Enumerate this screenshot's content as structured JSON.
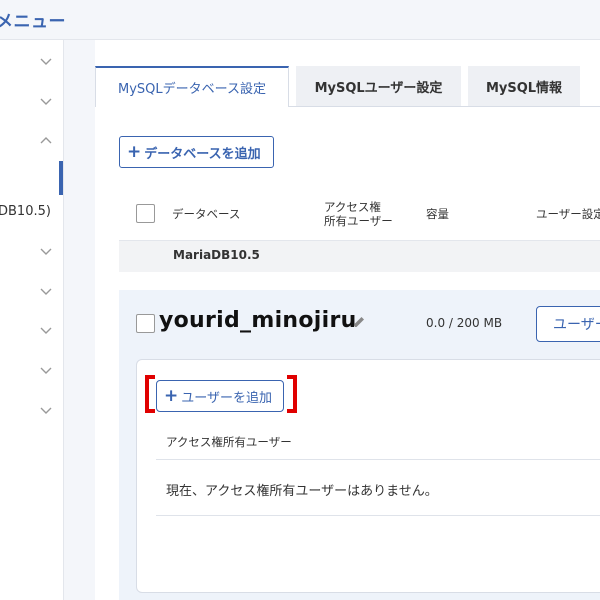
{
  "header": {
    "title": "メニュー"
  },
  "sidebar": {
    "partial_item_label": "DB10.5)"
  },
  "tabs": [
    {
      "label": "MySQLデータベース設定",
      "active": true
    },
    {
      "label": "MySQLユーザー設定",
      "active": false
    },
    {
      "label": "MySQL情報",
      "active": false
    }
  ],
  "actions": {
    "add_database": "データベースを追加"
  },
  "table": {
    "headers": {
      "database": "データベース",
      "access_line1": "アクセス権",
      "access_line2": "所有ユーザー",
      "capacity": "容量",
      "user_settings": "ユーザー設定"
    }
  },
  "group": {
    "label": "MariaDB10.5"
  },
  "database": {
    "name": "yourid_minojiru",
    "capacity": "0.0 / 200 MB",
    "user_button": "ユーザー"
  },
  "users_panel": {
    "add_user": "ユーザーを追加",
    "column_header": "アクセス権所有ユーザー",
    "empty_message": "現在、アクセス権所有ユーザーはありません。"
  },
  "colors": {
    "accent": "#3a64b0",
    "highlight": "#e00000",
    "panel": "#eef3fa"
  }
}
